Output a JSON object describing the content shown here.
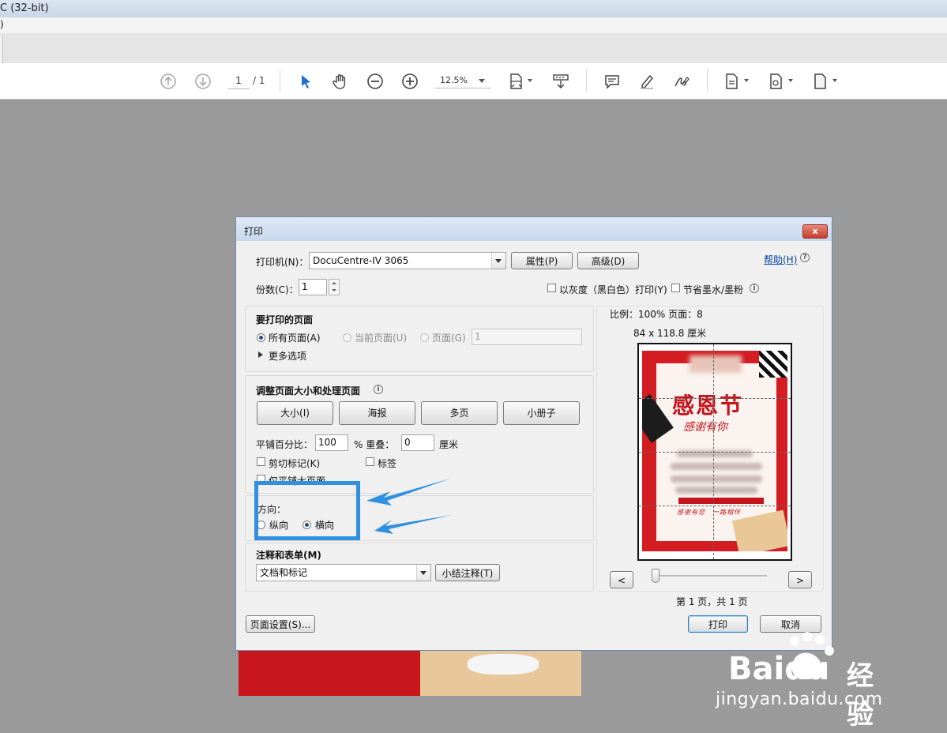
{
  "window": {
    "title": "C (32-bit)"
  },
  "menubar": {
    "fragment": ")"
  },
  "toolbar": {
    "page_current": "1",
    "page_total": "/ 1",
    "zoom": "12.5%",
    "icons": [
      "arrow-up-circle-icon",
      "arrow-down-circle-icon",
      "select-arrow-icon",
      "hand-icon",
      "zoom-out-icon",
      "zoom-in-icon",
      "fit-page-icon",
      "scroll-icon",
      "comment-icon",
      "highlight-icon",
      "sign-icon",
      "page-tool-icon",
      "page-settings-icon",
      "page-menu-icon"
    ]
  },
  "dialog": {
    "title": "打印",
    "close_glyph": "x",
    "printer": {
      "label": "打印机(N)：",
      "value": "DocuCentre-IV 3065",
      "properties_btn": "属性(P)",
      "advanced_btn": "高级(D)",
      "help_link": "帮助(H)"
    },
    "copies": {
      "label": "份数(C)：",
      "value": "1"
    },
    "grayscale": {
      "label": "以灰度（黑白色）打印(Y)",
      "checked": false
    },
    "save_ink": {
      "label": "节省墨水/墨粉",
      "checked": false
    },
    "pages_section": {
      "title": "要打印的页面",
      "all_pages": "所有页面(A)",
      "current_page": "当前页面(U)",
      "pages": "页面(G)",
      "pages_value": "1",
      "more_options": "更多选项",
      "selected": "all"
    },
    "sizing_section": {
      "title": "调整页面大小和处理页面",
      "buttons": [
        "大小(I)",
        "海报",
        "多页",
        "小册子"
      ],
      "tile_scale_label": "平铺百分比：",
      "tile_scale_value": "100",
      "overlap_label": "% 重叠：",
      "overlap_value": "0",
      "overlap_unit": "厘米",
      "cut_marks": "剪切标记(K)",
      "labels": "标签",
      "tile_large_only": "仅平铺大页面"
    },
    "orientation_section": {
      "title": "方向：",
      "portrait": "纵向",
      "landscape": "横向",
      "selected": "landscape"
    },
    "comments_section": {
      "title": "注释和表单(M)",
      "value": "文档和标记",
      "summarize_btn": "小结注释(T)"
    },
    "preview": {
      "scale": "比例：100% 页面：8",
      "size": "84 x 118.8 厘米",
      "prev_btn": "<",
      "next_btn": ">",
      "page_indicator": "第 1 页，共 1 页",
      "slider_position": 0,
      "poster_title": "感恩节",
      "poster_subtitle": "感谢有你",
      "poster_tagline": "感谢有您　一路相伴"
    },
    "page_setup_btn": "页面设置(S)...",
    "print_btn": "打印",
    "cancel_btn": "取消"
  },
  "colors": {
    "accent_blue": "#2f8fe0",
    "close_red": "#c7402d"
  },
  "watermark": {
    "brand": "Baidu",
    "suffix": "经验",
    "url": "jingyan.baidu.com"
  }
}
